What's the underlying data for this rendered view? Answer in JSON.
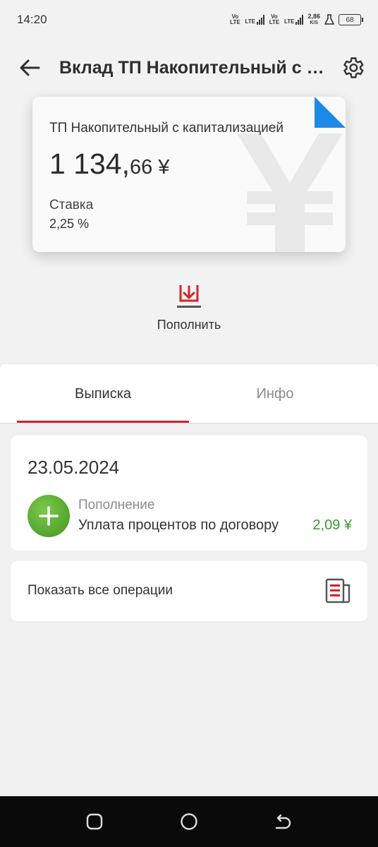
{
  "status_bar": {
    "time": "14:20",
    "sim1_label": "Vo LTE",
    "lte1_label": "LTE",
    "sim2_label": "Vo LTE",
    "lte2_label": "LTE",
    "speed_value": "2,86",
    "speed_unit": "K/S",
    "battery": "68"
  },
  "header": {
    "title": "Вклад ТП Накопительный с капитализацией",
    "back_icon": "arrow-left",
    "settings_icon": "gear"
  },
  "card": {
    "name": "ТП Накопительный с капитализацией",
    "amount_int": "1 134,",
    "amount_frac": "66",
    "currency": "¥",
    "rate_label": "Ставка",
    "rate_value": "2,25 %",
    "corner_color": "#1e88e5"
  },
  "actions": {
    "topup_label": "Пополнить",
    "topup_icon": "download-into-tray",
    "accent": "#d2232a"
  },
  "tabs": {
    "statement": "Выписка",
    "info": "Инфо",
    "active": "statement"
  },
  "operations": {
    "date": "23.05.2024",
    "items": [
      {
        "type": "Пополнение",
        "description": "Уплата процентов по договору",
        "amount": "2,09 ¥",
        "icon": "plus-circle",
        "icon_color": "#5fb336",
        "amount_color": "#3a9a2f"
      }
    ]
  },
  "all_operations": {
    "label": "Показать все операции",
    "icon": "statement-document"
  },
  "nav_bar": {
    "recent_icon": "square",
    "home_icon": "circle",
    "back_icon": "return-arrow"
  }
}
